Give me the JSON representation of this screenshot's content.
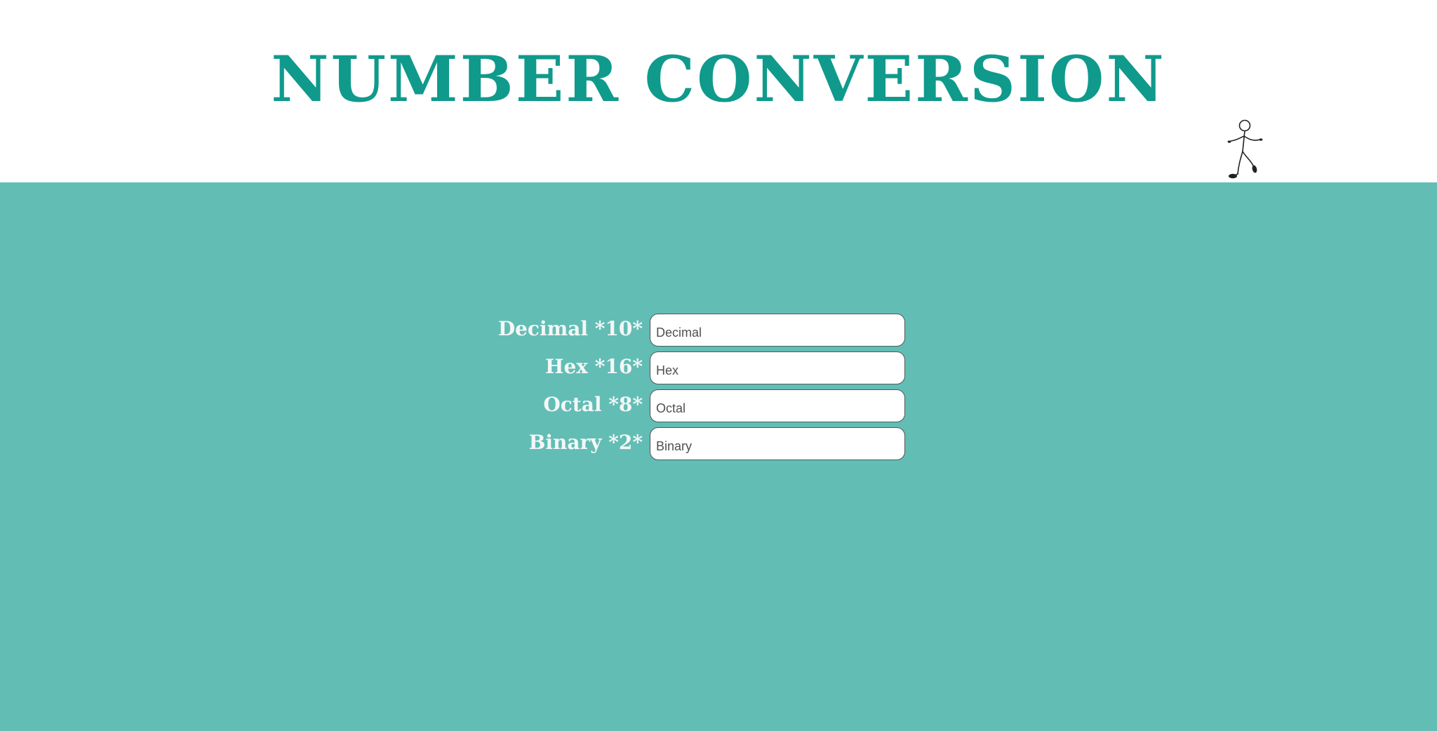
{
  "header": {
    "title": "Number Conversion",
    "mascot_icon": "stick-figure-icon"
  },
  "colors": {
    "title": "#0f9a8c",
    "background_main": "#62bdb5",
    "background_header": "#ffffff",
    "label_text": "#f4f7f6"
  },
  "form": {
    "decimal": {
      "label": "Decimal *10*",
      "placeholder": "Decimal",
      "value": ""
    },
    "hex": {
      "label": "Hex *16*",
      "placeholder": "Hex",
      "value": ""
    },
    "octal": {
      "label": "Octal *8*",
      "placeholder": "Octal",
      "value": ""
    },
    "binary": {
      "label": "Binary *2*",
      "placeholder": "Binary",
      "value": ""
    }
  }
}
